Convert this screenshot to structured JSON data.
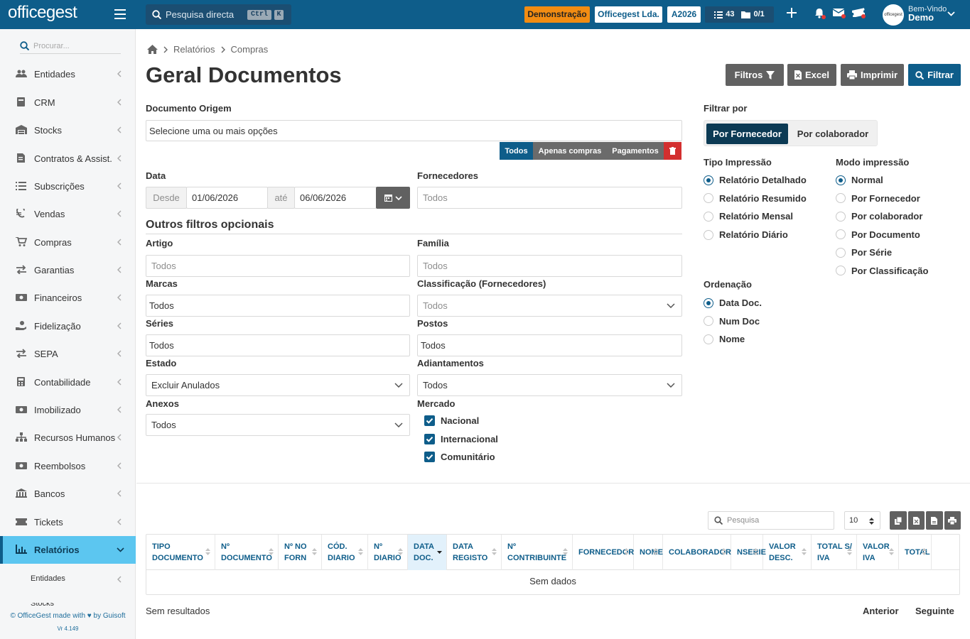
{
  "app": {
    "logo": "officegest",
    "colors": {
      "primary": "#0e5d8a",
      "accent": "#f28c12",
      "active_menu": "#5cc6f0",
      "danger": "#d32f2f"
    }
  },
  "topbar": {
    "search_placeholder": "Pesquisa directa",
    "kbd_ctrl": "Ctrl",
    "kbd_k": "K",
    "demo_label": "Demonstração",
    "company": "Officegest Lda.",
    "year": "A2026",
    "tasks_count": "43",
    "docs_count": "0/1",
    "welcome": "Bem-Vindo",
    "user": "Demo",
    "avatar_text": "officegest"
  },
  "sidebar": {
    "search_placeholder": "Procurar...",
    "items": [
      {
        "label": "Entidades",
        "icon": "users-icon"
      },
      {
        "label": "CRM",
        "icon": "book-icon"
      },
      {
        "label": "Stocks",
        "icon": "warehouse-icon"
      },
      {
        "label": "Contratos & Assist.",
        "icon": "file-contract-icon"
      },
      {
        "label": "Subscrições",
        "icon": "list-icon"
      },
      {
        "label": "Vendas",
        "icon": "euro-icon"
      },
      {
        "label": "Compras",
        "icon": "cart-icon"
      },
      {
        "label": "Garantias",
        "icon": "exchange-icon"
      },
      {
        "label": "Financeiros",
        "icon": "money-icon"
      },
      {
        "label": "Fidelização",
        "icon": "hand-coin-icon"
      },
      {
        "label": "SEPA",
        "icon": "exchange-icon"
      },
      {
        "label": "Contabilidade",
        "icon": "calculator-icon"
      },
      {
        "label": "Imobilizado",
        "icon": "money-icon"
      },
      {
        "label": "Recursos Humanos",
        "icon": "sitemap-icon"
      },
      {
        "label": "Reembolsos",
        "icon": "money-icon"
      },
      {
        "label": "Bancos",
        "icon": "bank-icon"
      },
      {
        "label": "Tickets",
        "icon": "ticket-icon"
      },
      {
        "label": "Relatórios",
        "icon": "chart-icon"
      }
    ],
    "submenu": [
      "Entidades",
      "Stocks"
    ],
    "footer": "© OfficeGest made with ♥ by Guisoft",
    "version": "Vr 4.149"
  },
  "breadcrumb": [
    "Relatórios",
    "Compras"
  ],
  "page_title": "Geral Documentos",
  "actions": {
    "filtros": "Filtros",
    "excel": "Excel",
    "imprimir": "Imprimir",
    "filtrar": "Filtrar"
  },
  "form": {
    "documento_origem": {
      "label": "Documento Origem",
      "placeholder": "Selecione uma ou mais opções"
    },
    "segments": [
      "Todos",
      "Apenas compras",
      "Pagamentos"
    ],
    "data": {
      "label": "Data",
      "desde": "Desde",
      "from": "01/06/2026",
      "ate": "até",
      "to": "06/06/2026"
    },
    "fornecedores": {
      "label": "Fornecedores",
      "placeholder": "Todos"
    },
    "outros": "Outros filtros opcionais",
    "artigo": {
      "label": "Artigo",
      "placeholder": "Todos"
    },
    "familia": {
      "label": "Família",
      "placeholder": "Todos"
    },
    "marcas": {
      "label": "Marcas",
      "value": "Todos"
    },
    "classificacao": {
      "label": "Classificação (Fornecedores)",
      "placeholder": "Todos"
    },
    "series": {
      "label": "Séries",
      "value": "Todos"
    },
    "postos": {
      "label": "Postos",
      "value": "Todos"
    },
    "estado": {
      "label": "Estado",
      "value": "Excluir Anulados"
    },
    "adiantamentos": {
      "label": "Adiantamentos",
      "value": "Todos"
    },
    "anexos": {
      "label": "Anexos",
      "value": "Todos"
    },
    "mercado": {
      "label": "Mercado",
      "options": [
        "Nacional",
        "Internacional",
        "Comunitário"
      ]
    }
  },
  "filtrar_por": {
    "label": "Filtrar por",
    "active": "Por Fornecedor",
    "other": "Por colaborador"
  },
  "tipo_impressao": {
    "label": "Tipo Impressão",
    "selected": 0,
    "options": [
      "Relatório Detalhado",
      "Relatório Resumido",
      "Relatório Mensal",
      "Relatório Diário"
    ]
  },
  "modo_impressao": {
    "label": "Modo impressão",
    "selected": 0,
    "options": [
      "Normal",
      "Por Fornecedor",
      "Por colaborador",
      "Por Documento",
      "Por Série",
      "Por Classificação"
    ]
  },
  "ordenacao": {
    "label": "Ordenação",
    "selected": 0,
    "options": [
      "Data Doc.",
      "Num Doc",
      "Nome"
    ]
  },
  "table": {
    "search_placeholder": "Pesquisa",
    "page_size": "10",
    "columns": [
      [
        "TIPO",
        "DOCUMENTO"
      ],
      [
        "Nº",
        "DOCUMENTO"
      ],
      [
        "Nº NO",
        "FORN"
      ],
      [
        "CÓD.",
        "DIARIO"
      ],
      [
        "Nº",
        "DIARIO"
      ],
      [
        "DATA",
        "DOC."
      ],
      [
        "DATA",
        "REGISTO"
      ],
      [
        "Nº",
        "CONTRIBUINTE"
      ],
      [
        "FORNECEDOR"
      ],
      [
        "NOME"
      ],
      [
        "COLABORADOR"
      ],
      [
        "NSERIE"
      ],
      [
        "VALOR",
        "DESC."
      ],
      [
        "TOTAL S/",
        "IVA"
      ],
      [
        "VALOR",
        "IVA"
      ],
      [
        "TOTAL"
      ]
    ],
    "empty": "Sem dados",
    "no_results": "Sem resultados",
    "prev": "Anterior",
    "next": "Seguinte"
  }
}
